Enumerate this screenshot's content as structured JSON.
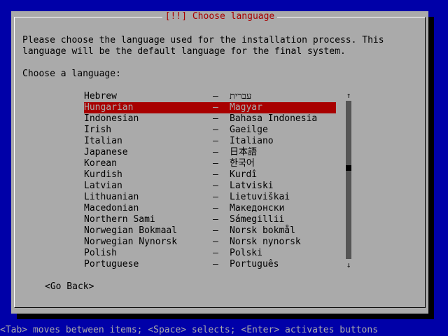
{
  "dialog": {
    "title": "[!!] Choose language",
    "description_line1": "Please choose the language used for the installation process. This",
    "description_line2": "language will be the default language for the final system.",
    "prompt": "Choose a language:"
  },
  "languages": [
    {
      "name": "Hebrew",
      "native": "עברית",
      "selected": false
    },
    {
      "name": "Hungarian",
      "native": "Magyar",
      "selected": true
    },
    {
      "name": "Indonesian",
      "native": "Bahasa Indonesia",
      "selected": false
    },
    {
      "name": "Irish",
      "native": "Gaeilge",
      "selected": false
    },
    {
      "name": "Italian",
      "native": "Italiano",
      "selected": false
    },
    {
      "name": "Japanese",
      "native": "日本語",
      "selected": false
    },
    {
      "name": "Korean",
      "native": "한국어",
      "selected": false
    },
    {
      "name": "Kurdish",
      "native": "Kurdî",
      "selected": false
    },
    {
      "name": "Latvian",
      "native": "Latviski",
      "selected": false
    },
    {
      "name": "Lithuanian",
      "native": "Lietuviškai",
      "selected": false
    },
    {
      "name": "Macedonian",
      "native": "Македонски",
      "selected": false
    },
    {
      "name": "Northern Sami",
      "native": "Sámegillii",
      "selected": false
    },
    {
      "name": "Norwegian Bokmaal",
      "native": "Norsk bokmål",
      "selected": false
    },
    {
      "name": "Norwegian Nynorsk",
      "native": "Norsk nynorsk",
      "selected": false
    },
    {
      "name": "Polish",
      "native": "Polski",
      "selected": false
    },
    {
      "name": "Portuguese",
      "native": "Português",
      "selected": false
    }
  ],
  "separator": "–",
  "scrollbar": {
    "up_arrow": "↑",
    "down_arrow": "↓",
    "position": 0.42
  },
  "go_back_label": "<Go Back>",
  "hint": "<Tab> moves between items; <Space> selects; <Enter> activates buttons",
  "colors": {
    "background": "#0000a8",
    "dialog": "#aaaaaa",
    "highlight": "#a80000"
  }
}
